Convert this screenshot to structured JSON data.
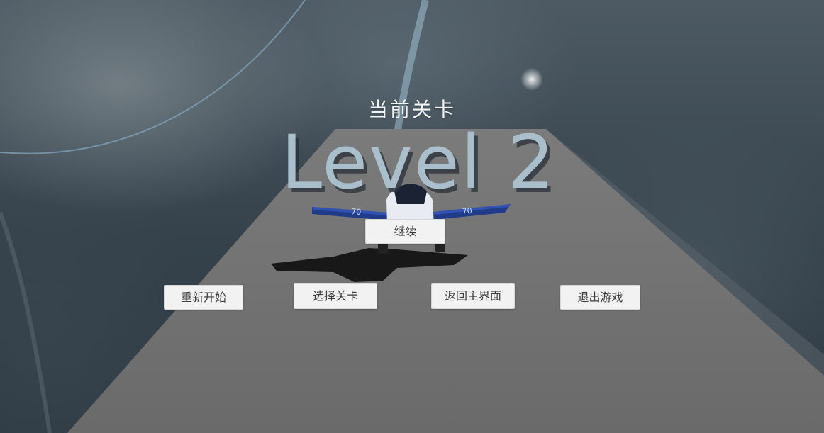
{
  "hud": {
    "current_level_label": "当前关卡",
    "level_text": "Level 2"
  },
  "menu": {
    "continue_label": "继续",
    "restart_label": "重新开始",
    "select_level_label": "选择关卡",
    "main_menu_label": "返回主界面",
    "quit_label": "退出游戏"
  },
  "plane": {
    "wing_decal": "70"
  },
  "colors": {
    "runway": "#6f6f6f",
    "level_text": "#a9c0cc",
    "wing_blue": "#1f3b8a",
    "button_bg": "#f2f2f2"
  }
}
